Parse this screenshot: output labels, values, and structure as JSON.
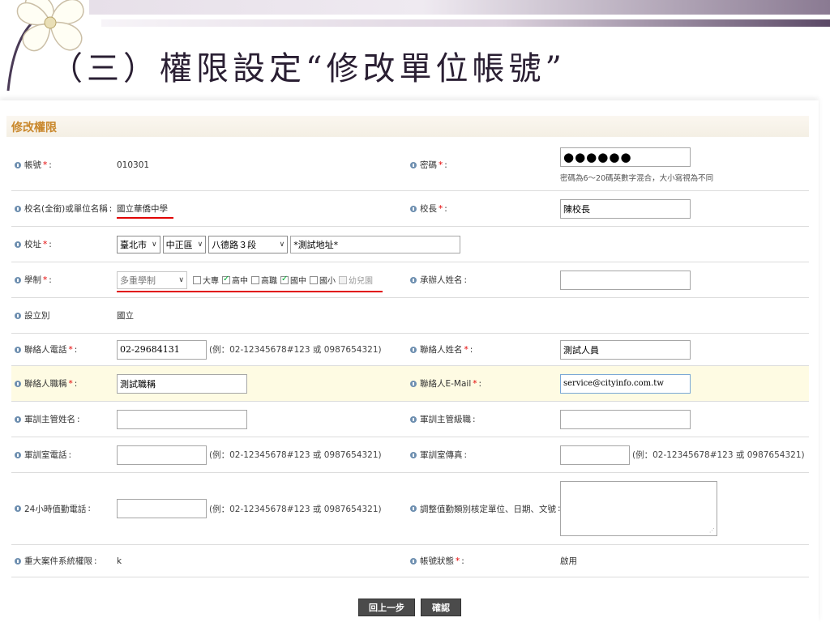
{
  "slide": {
    "title": "（三）權限設定“修改單位帳號”"
  },
  "panel": {
    "title": "修改權限"
  },
  "form": {
    "account": {
      "label": "帳號",
      "value": "010301"
    },
    "password": {
      "label": "密碼",
      "masked": "●●●●●●",
      "note": "密碼為6～20碼英數字混合，大小寫視為不同"
    },
    "school": {
      "label": "校名(全銜)或單位名稱",
      "value": "國立華僑中學"
    },
    "principal": {
      "label": "校長",
      "value": "陳校長"
    },
    "address": {
      "label": "校址",
      "city": "臺北市",
      "district": "中正區",
      "road": "八德路３段",
      "detail": "*測試地址*"
    },
    "system": {
      "label": "學制",
      "select": "多重學制",
      "options": [
        {
          "text": "大專",
          "checked": false
        },
        {
          "text": "高中",
          "checked": true
        },
        {
          "text": "高職",
          "checked": false
        },
        {
          "text": "國中",
          "checked": true
        },
        {
          "text": "國小",
          "checked": false
        },
        {
          "text": "幼兒園",
          "checked": false
        }
      ]
    },
    "handler": {
      "label": "承辦人姓名",
      "value": ""
    },
    "founding": {
      "label": "設立別",
      "value": "國立"
    },
    "phone_hint": "(例：02-12345678#123 或 0987654321)",
    "contact_phone": {
      "label": "聯絡人電話",
      "value": "02-29684131"
    },
    "contact_name": {
      "label": "聯絡人姓名",
      "value": "測試人員"
    },
    "contact_title": {
      "label": "聯絡人職稱",
      "value": "測試職稱"
    },
    "contact_email": {
      "label": "聯絡人E-Mail",
      "value": "service@cityinfo.com.tw"
    },
    "mil_head_name": {
      "label": "軍訓主管姓名",
      "value": ""
    },
    "mil_head_rank": {
      "label": "軍訓主管級職",
      "value": ""
    },
    "mil_phone": {
      "label": "軍訓室電話",
      "value": ""
    },
    "mil_fax": {
      "label": "軍訓室傳真",
      "value": ""
    },
    "duty_phone": {
      "label": "24小時值勤電話",
      "value": ""
    },
    "duty_adjust": {
      "label": "調整值勤類別核定單位、日期、文號",
      "value": ""
    },
    "major_case": {
      "label": "重大案件系統權限",
      "value": "k"
    },
    "status": {
      "label": "帳號狀態",
      "value": "啟用"
    }
  },
  "buttons": {
    "back": "回上一步",
    "confirm": "確認"
  }
}
